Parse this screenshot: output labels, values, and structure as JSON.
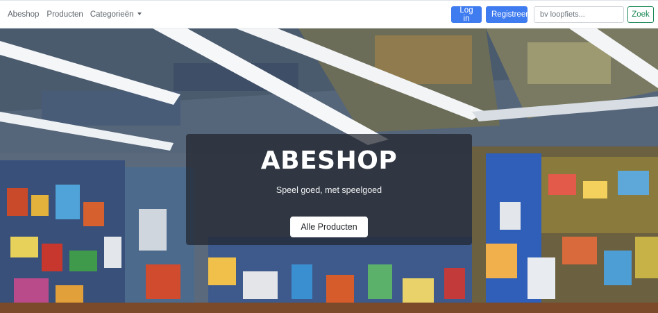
{
  "navbar": {
    "brand": "Abeshop",
    "links": [
      "Producten"
    ],
    "dropdown_label": "Categorieën",
    "login_label": "Log in",
    "register_label": "Registreer",
    "search_placeholder": "bv loopfiets...",
    "search_button_label": "Zoek"
  },
  "hero": {
    "title": "ABESHOP",
    "subtitle": "Speel goed, met speelgoed",
    "cta_label": "Alle Producten"
  },
  "colors": {
    "primary": "#3f7cf0",
    "success": "#198754",
    "overlay": "rgba(32,36,44,0.72)"
  }
}
